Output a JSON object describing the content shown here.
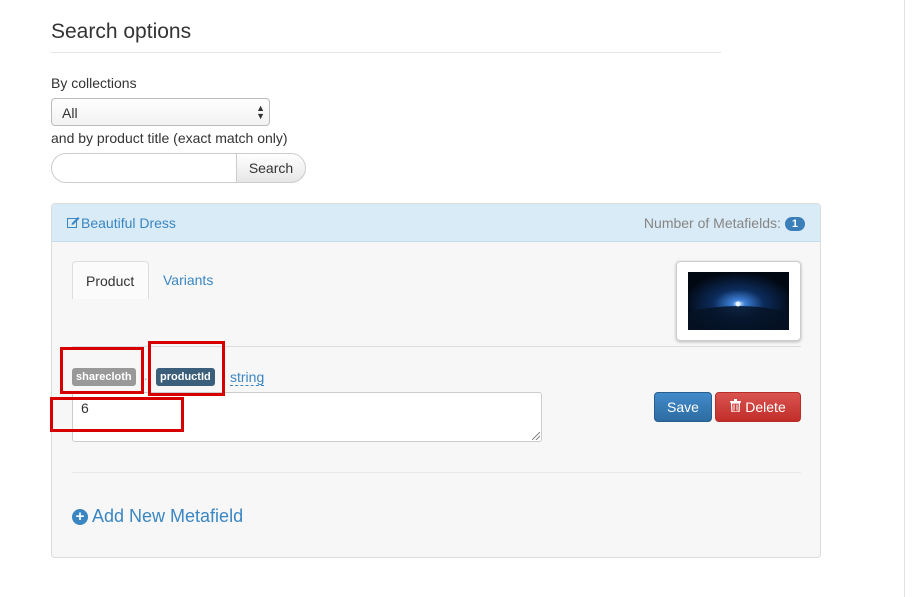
{
  "search": {
    "title": "Search options",
    "collections_label": "By collections",
    "collection_selected": "All",
    "title_label": "and by product title (exact match only)",
    "title_value": "",
    "search_button": "Search"
  },
  "product_panel": {
    "product_name": "Beautiful Dress",
    "metafields_label": "Number of Metafields:",
    "metafields_count": "1",
    "tabs": [
      {
        "label": "Product",
        "active": true
      },
      {
        "label": "Variants",
        "active": false
      }
    ],
    "thumbnail_icon": "product-thumbnail",
    "metafield": {
      "namespace": "sharecloth",
      "key": "productId",
      "value_type": "string",
      "value": "6"
    },
    "save_label": "Save",
    "delete_label": "Delete",
    "add_label": "Add New Metafield"
  },
  "colors": {
    "primary": "#428bca",
    "danger": "#d9534f",
    "highlight": "#d60000",
    "link": "#3a86c2"
  }
}
